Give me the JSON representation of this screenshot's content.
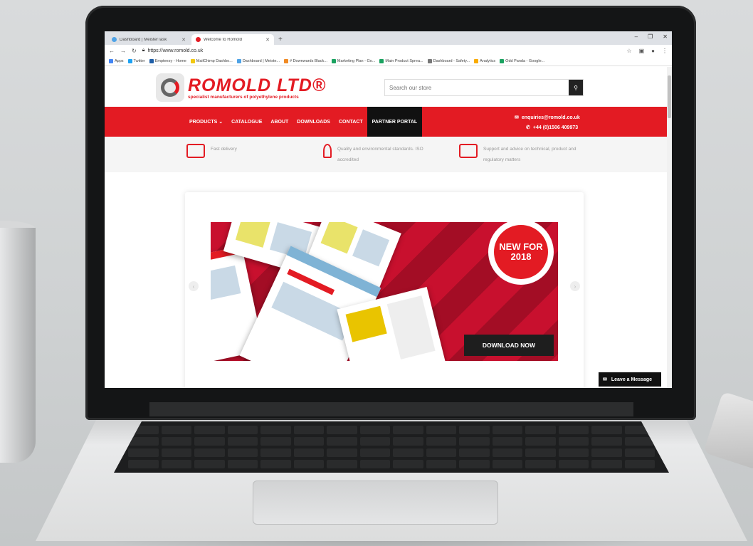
{
  "browser": {
    "tabs": [
      {
        "title": "Dashboard | MeisterTask",
        "favicon_color": "#4fa3e6",
        "active": false
      },
      {
        "title": "Welcome to Romold",
        "favicon_color": "#e31b23",
        "active": true
      }
    ],
    "new_tab_symbol": "+",
    "window_controls": [
      "–",
      "❐",
      "✕"
    ],
    "url": "https://www.romold.co.uk",
    "bookmarks": [
      {
        "label": "Apps",
        "color": "#4285f4"
      },
      {
        "label": "Twitter",
        "color": "#1da1f2"
      },
      {
        "label": "Empteezy - Home",
        "color": "#1f5fa8"
      },
      {
        "label": "MailChimp Dashbo...",
        "color": "#f2c811"
      },
      {
        "label": "Dashboard | Meiste...",
        "color": "#4fa3e6"
      },
      {
        "label": "# Downwards Black...",
        "color": "#f08a24"
      },
      {
        "label": "Marketing Plan - Go...",
        "color": "#1aa260"
      },
      {
        "label": "Main Product Sprea...",
        "color": "#1aa260"
      },
      {
        "label": "Dashboard - Safety...",
        "color": "#777777"
      },
      {
        "label": "Analytics",
        "color": "#f9ab00"
      },
      {
        "label": "Odd Panda - Google...",
        "color": "#1aa260"
      }
    ]
  },
  "site": {
    "brand": {
      "name": "ROMOLD LTD®",
      "tagline": "specialist manufacturers of polyethylene products",
      "color": "#e31b23"
    },
    "search": {
      "placeholder": "Search our store",
      "icon": "search-icon"
    },
    "nav": [
      "PRODUCTS ⌄",
      "CATALOGUE",
      "ABOUT",
      "DOWNLOADS",
      "CONTACT",
      "PARTNER PORTAL"
    ],
    "contact": {
      "email": "enquiries@romold.co.uk",
      "phone": "+44 (0)1506 409973"
    },
    "usps": [
      {
        "text": "Fast delivery",
        "icon": "truck-check-icon"
      },
      {
        "text": "Quality and environmental standards. ISO accredited",
        "icon": "ribbon-award-icon"
      },
      {
        "text": "Support and advice on technical, product and regulatory matters",
        "icon": "truck-check-icon"
      }
    ],
    "banner": {
      "badge": "NEW FOR 2018",
      "button": "DOWNLOAD NOW"
    },
    "chat": {
      "label": "Leave a Message",
      "icon": "envelope-icon"
    }
  }
}
